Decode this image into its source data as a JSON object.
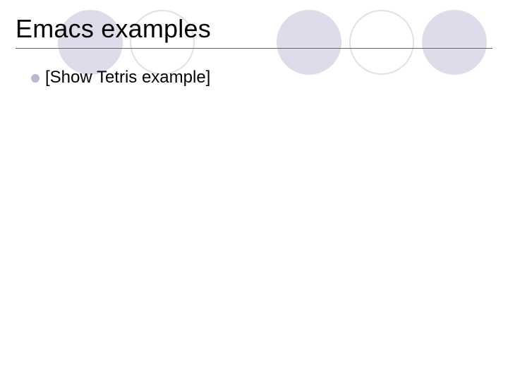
{
  "slide": {
    "title": "Emacs examples",
    "bullets": [
      {
        "text": "[Show Tetris example]"
      }
    ]
  },
  "decor": {
    "circle_fill": "#dcdcea",
    "circle_stroke": "#e0e0ec",
    "bullet_color": "#b9b9d1"
  }
}
